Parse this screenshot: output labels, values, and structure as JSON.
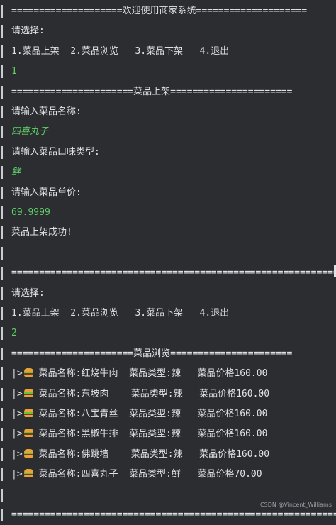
{
  "console": {
    "lines": [
      {
        "kind": "output",
        "text": "====================欢迎使用商家系统===================="
      },
      {
        "kind": "output",
        "text": "请选择:"
      },
      {
        "kind": "output",
        "text": "1.菜品上架  2.菜品浏览   3.菜品下架   4.退出"
      },
      {
        "kind": "input",
        "text": "1"
      },
      {
        "kind": "output",
        "text": "======================菜品上架======================"
      },
      {
        "kind": "output",
        "text": "请输入菜品名称:"
      },
      {
        "kind": "input-italic",
        "text": "四喜丸子"
      },
      {
        "kind": "output",
        "text": "请输入菜品口味类型:"
      },
      {
        "kind": "input-italic",
        "text": "鲜"
      },
      {
        "kind": "output",
        "text": "请输入菜品单价:"
      },
      {
        "kind": "input",
        "text": "69.9999"
      },
      {
        "kind": "output",
        "text": "菜品上架成功!"
      },
      {
        "kind": "output",
        "text": ""
      },
      {
        "kind": "output",
        "text": "============================================================"
      },
      {
        "kind": "output",
        "text": "请选择:"
      },
      {
        "kind": "output",
        "text": "1.菜品上架  2.菜品浏览   3.菜品下架   4.退出"
      },
      {
        "kind": "input",
        "text": "2"
      },
      {
        "kind": "output",
        "text": "======================菜品浏览======================"
      },
      {
        "kind": "dish",
        "prefix": "|>",
        "text": "菜品名称:红烧牛肉  菜品类型:辣   菜品价格160.00"
      },
      {
        "kind": "dish",
        "prefix": "|>",
        "text": "菜品名称:东坡肉    菜品类型:辣   菜品价格160.00"
      },
      {
        "kind": "dish",
        "prefix": "|>",
        "text": "菜品名称:八宝青丝  菜品类型:辣   菜品价格160.00"
      },
      {
        "kind": "dish",
        "prefix": "|>",
        "text": "菜品名称:黑椒牛排  菜品类型:辣   菜品价格160.00"
      },
      {
        "kind": "dish",
        "prefix": "|>",
        "text": "菜品名称:佛跳墙    菜品类型:辣   菜品价格160.00"
      },
      {
        "kind": "dish",
        "prefix": "|>",
        "text": "菜品名称:四喜丸子  菜品类型:鲜   菜品价格70.00"
      },
      {
        "kind": "output",
        "text": ""
      },
      {
        "kind": "output",
        "text": "=================================================================="
      }
    ],
    "colors": {
      "background": "#2b2d30",
      "text": "#dfe1e5",
      "input": "#5fd068"
    },
    "dish_icon": "hamburger-icon"
  },
  "watermark": "CSDN @Vincent_Williams"
}
